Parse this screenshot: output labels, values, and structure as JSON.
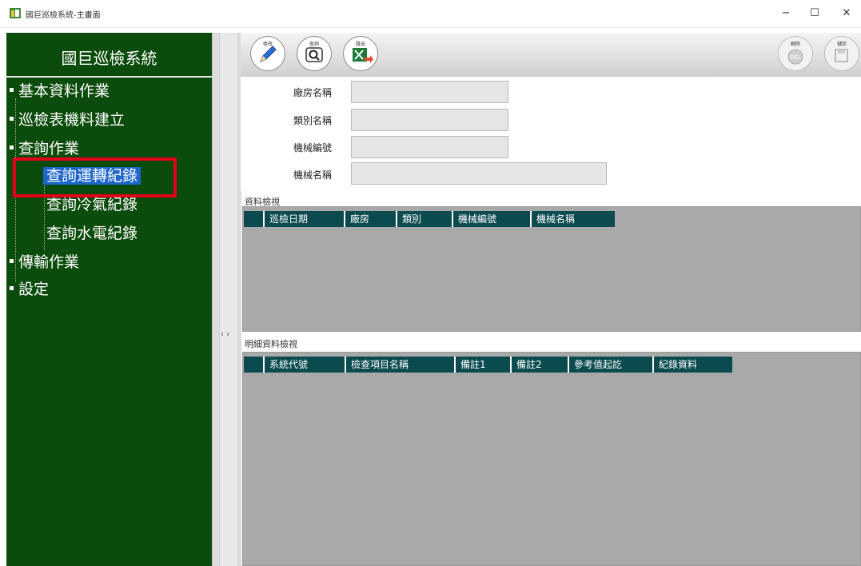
{
  "window": {
    "title": "國巨巡檢系統-主畫面",
    "minimize": "−",
    "maximize": "☐",
    "close": "✕"
  },
  "sidebar": {
    "title": "國巨巡檢系統",
    "items": [
      {
        "label": "基本資料作業"
      },
      {
        "label": "巡檢表機料建立"
      },
      {
        "label": "查詢作業",
        "children": [
          {
            "label": "查詢運轉紀錄"
          },
          {
            "label": "查詢冷氣紀錄"
          },
          {
            "label": "查詢水電紀錄"
          }
        ]
      },
      {
        "label": "傳輸作業"
      },
      {
        "label": "設定"
      }
    ]
  },
  "toolbar": {
    "buttons": [
      {
        "caption": "修改",
        "icon": "pencil-icon"
      },
      {
        "caption": "查詢",
        "icon": "magnifier-icon"
      },
      {
        "caption": "匯出",
        "icon": "excel-export-icon"
      },
      {
        "caption": "刪除",
        "icon": "delete-icon",
        "disabled": true
      },
      {
        "caption": "儲存",
        "icon": "save-icon",
        "disabled": true
      }
    ]
  },
  "form": {
    "fields": [
      {
        "label": "廠房名稱",
        "value": ""
      },
      {
        "label": "類別名稱",
        "value": ""
      },
      {
        "label": "機械編號",
        "value": ""
      },
      {
        "label": "機械名稱",
        "value": ""
      }
    ]
  },
  "data_view": {
    "title": "資料檢視",
    "columns": [
      "巡檢日期",
      "廠房",
      "類別",
      "機械編號",
      "機械名稱"
    ]
  },
  "detail_view": {
    "title": "明細資料檢視",
    "columns": [
      "系統代號",
      "檢查項目名稱",
      "備註1",
      "備註2",
      "參考值起訖",
      "紀錄資料"
    ]
  },
  "colors": {
    "sidebar_bg": "#0b4b0b",
    "header_bg": "#0b4b4f",
    "selected": "#1e66cc",
    "highlight": "#e3001b"
  }
}
